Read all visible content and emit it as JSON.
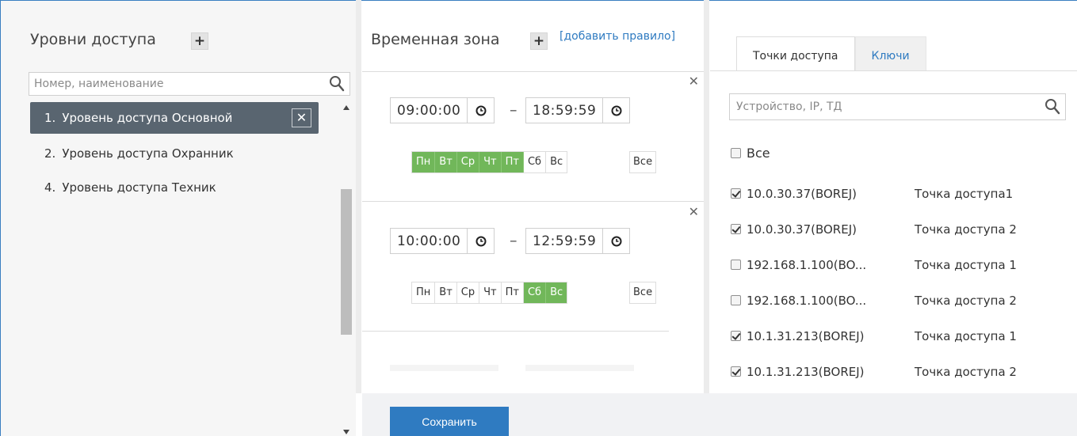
{
  "access_levels": {
    "title": "Уровни доступа",
    "search_placeholder": "Номер, наименование",
    "items": [
      {
        "num": "1.",
        "label": "Уровень доступа Основной",
        "active": true
      },
      {
        "num": "2.",
        "label": "Уровень доступа Охранник",
        "active": false
      },
      {
        "num": "4.",
        "label": "Уровень доступа Техник",
        "active": false
      }
    ]
  },
  "time_zone": {
    "title": "Временная зона",
    "add_rule": "[добавить правило]",
    "all_label": "Все",
    "rules": [
      {
        "start": "09:00:00",
        "end": "18:59:59",
        "days": [
          {
            "label": "Пн",
            "on": true
          },
          {
            "label": "Вт",
            "on": true
          },
          {
            "label": "Ср",
            "on": true
          },
          {
            "label": "Чт",
            "on": true
          },
          {
            "label": "Пт",
            "on": true
          },
          {
            "label": "Сб",
            "on": false
          },
          {
            "label": "Вс",
            "on": false
          }
        ]
      },
      {
        "start": "10:00:00",
        "end": "12:59:59",
        "days": [
          {
            "label": "Пн",
            "on": false
          },
          {
            "label": "Вт",
            "on": false
          },
          {
            "label": "Ср",
            "on": false
          },
          {
            "label": "Чт",
            "on": false
          },
          {
            "label": "Пт",
            "on": false
          },
          {
            "label": "Сб",
            "on": true
          },
          {
            "label": "Вс",
            "on": true
          }
        ]
      }
    ]
  },
  "right_panel": {
    "tabs": [
      {
        "label": "Точки доступа",
        "active": true
      },
      {
        "label": "Ключи",
        "active": false
      }
    ],
    "search_placeholder": "Устройство, IP, ТД",
    "all_label": "Все",
    "all_checked": false,
    "access_points": [
      {
        "device": "10.0.30.37(BOREJ)",
        "name": "Точка доступа1",
        "checked": true
      },
      {
        "device": "10.0.30.37(BOREJ)",
        "name": "Точка доступа 2",
        "checked": true
      },
      {
        "device": "192.168.1.100(BO...",
        "name": "Точка доступа 1",
        "checked": false
      },
      {
        "device": "192.168.1.100(BO...",
        "name": "Точка доступа 2",
        "checked": false
      },
      {
        "device": "10.1.31.213(BOREJ)",
        "name": "Точка доступа 1",
        "checked": true
      },
      {
        "device": "10.1.31.213(BOREJ)",
        "name": "Точка доступа 2",
        "checked": true
      }
    ]
  },
  "footer": {
    "save_label": "Сохранить"
  },
  "colors": {
    "accent": "#2f7bc1",
    "active_item": "#596570",
    "day_on": "#71b75a"
  }
}
